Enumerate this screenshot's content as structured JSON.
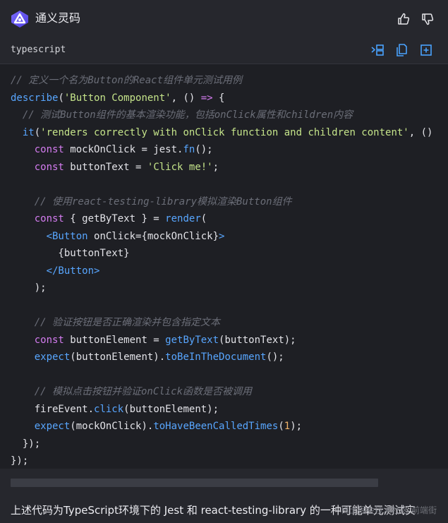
{
  "app": {
    "title": "通义灵码",
    "logo_icon": "tongyi-lingma-logo",
    "thumbs_up_icon": "thumbs-up-icon",
    "thumbs_down_icon": "thumbs-down-icon"
  },
  "code_block": {
    "language": "typescript",
    "actions": [
      "insert-code-icon",
      "copy-icon",
      "new-file-icon"
    ],
    "lines": [
      [
        {
          "t": "// 定义一个名为Button的React组件单元测试用例",
          "c": "comment"
        }
      ],
      [
        {
          "t": "describe",
          "c": "fn"
        },
        {
          "t": "(",
          "c": "plain"
        },
        {
          "t": "'Button Component'",
          "c": "str"
        },
        {
          "t": ", () ",
          "c": "plain"
        },
        {
          "t": "=>",
          "c": "kw"
        },
        {
          "t": " {",
          "c": "plain"
        }
      ],
      [
        {
          "t": "  ",
          "c": "plain"
        },
        {
          "t": "// 测试Button组件的基本渲染功能，包括onClick属性和children内容",
          "c": "comment"
        }
      ],
      [
        {
          "t": "  ",
          "c": "plain"
        },
        {
          "t": "it",
          "c": "fn"
        },
        {
          "t": "(",
          "c": "plain"
        },
        {
          "t": "'renders correctly with onClick function and children content'",
          "c": "str"
        },
        {
          "t": ", () => {",
          "c": "plain"
        }
      ],
      [
        {
          "t": "    ",
          "c": "plain"
        },
        {
          "t": "const",
          "c": "kw"
        },
        {
          "t": " mockOnClick = jest.",
          "c": "plain"
        },
        {
          "t": "fn",
          "c": "fn"
        },
        {
          "t": "();",
          "c": "plain"
        }
      ],
      [
        {
          "t": "    ",
          "c": "plain"
        },
        {
          "t": "const",
          "c": "kw"
        },
        {
          "t": " buttonText = ",
          "c": "plain"
        },
        {
          "t": "'Click me!'",
          "c": "str"
        },
        {
          "t": ";",
          "c": "plain"
        }
      ],
      [
        {
          "t": "",
          "c": "plain"
        }
      ],
      [
        {
          "t": "    ",
          "c": "plain"
        },
        {
          "t": "// 使用react-testing-library模拟渲染Button组件",
          "c": "comment"
        }
      ],
      [
        {
          "t": "    ",
          "c": "plain"
        },
        {
          "t": "const",
          "c": "kw"
        },
        {
          "t": " { getByText } = ",
          "c": "plain"
        },
        {
          "t": "render",
          "c": "fn"
        },
        {
          "t": "(",
          "c": "plain"
        }
      ],
      [
        {
          "t": "      ",
          "c": "plain"
        },
        {
          "t": "<Button",
          "c": "fn"
        },
        {
          "t": " onClick={mockOnClick}",
          "c": "plain"
        },
        {
          "t": ">",
          "c": "fn"
        }
      ],
      [
        {
          "t": "        {buttonText}",
          "c": "plain"
        }
      ],
      [
        {
          "t": "      ",
          "c": "plain"
        },
        {
          "t": "</Button>",
          "c": "fn"
        }
      ],
      [
        {
          "t": "    );",
          "c": "plain"
        }
      ],
      [
        {
          "t": "",
          "c": "plain"
        }
      ],
      [
        {
          "t": "    ",
          "c": "plain"
        },
        {
          "t": "// 验证按钮是否正确渲染并包含指定文本",
          "c": "comment"
        }
      ],
      [
        {
          "t": "    ",
          "c": "plain"
        },
        {
          "t": "const",
          "c": "kw"
        },
        {
          "t": " buttonElement = ",
          "c": "plain"
        },
        {
          "t": "getByText",
          "c": "fn"
        },
        {
          "t": "(buttonText);",
          "c": "plain"
        }
      ],
      [
        {
          "t": "    ",
          "c": "plain"
        },
        {
          "t": "expect",
          "c": "fn"
        },
        {
          "t": "(buttonElement).",
          "c": "plain"
        },
        {
          "t": "toBeInTheDocument",
          "c": "fn"
        },
        {
          "t": "();",
          "c": "plain"
        }
      ],
      [
        {
          "t": "",
          "c": "plain"
        }
      ],
      [
        {
          "t": "    ",
          "c": "plain"
        },
        {
          "t": "// 模拟点击按钮并验证onClick函数是否被调用",
          "c": "comment"
        }
      ],
      [
        {
          "t": "    fireEvent.",
          "c": "plain"
        },
        {
          "t": "click",
          "c": "fn"
        },
        {
          "t": "(buttonElement);",
          "c": "plain"
        }
      ],
      [
        {
          "t": "    ",
          "c": "plain"
        },
        {
          "t": "expect",
          "c": "fn"
        },
        {
          "t": "(mockOnClick).",
          "c": "plain"
        },
        {
          "t": "toHaveBeenCalledTimes",
          "c": "fn"
        },
        {
          "t": "(",
          "c": "plain"
        },
        {
          "t": "1",
          "c": "num"
        },
        {
          "t": ");",
          "c": "plain"
        }
      ],
      [
        {
          "t": "  });",
          "c": "plain"
        }
      ],
      [
        {
          "t": "});",
          "c": "plain"
        }
      ]
    ]
  },
  "footer": {
    "summary": "上述代码为TypeScript环境下的 Jest 和 react-testing-library 的一种可能单元测试实",
    "watermark": "稀土掘金技术社区 前端街"
  },
  "colors": {
    "background": "#26272d",
    "code_background": "#1e1f24",
    "accent_blue": "#58a6ff",
    "string_green": "#c5e48a",
    "keyword_purple": "#d47cf0",
    "comment_gray": "#6b6e78"
  }
}
